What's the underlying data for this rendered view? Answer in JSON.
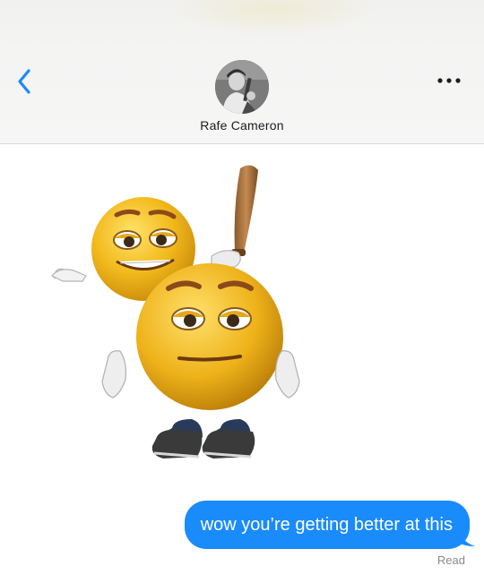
{
  "header": {
    "contact_name": "Rafe Cameron",
    "back_icon": "chevron-left-icon",
    "more_icon": "ellipsis-icon",
    "accent_color": "#1a8bfb"
  },
  "messages": [
    {
      "type": "image",
      "direction": "incoming",
      "content": "two yellow emoji faces; one holding a baseball bat above the other"
    },
    {
      "type": "text",
      "direction": "outgoing",
      "text": "wow you’re getting better at this",
      "bubble_color": "#1a8bfb"
    }
  ],
  "receipt": {
    "status": "Read"
  }
}
